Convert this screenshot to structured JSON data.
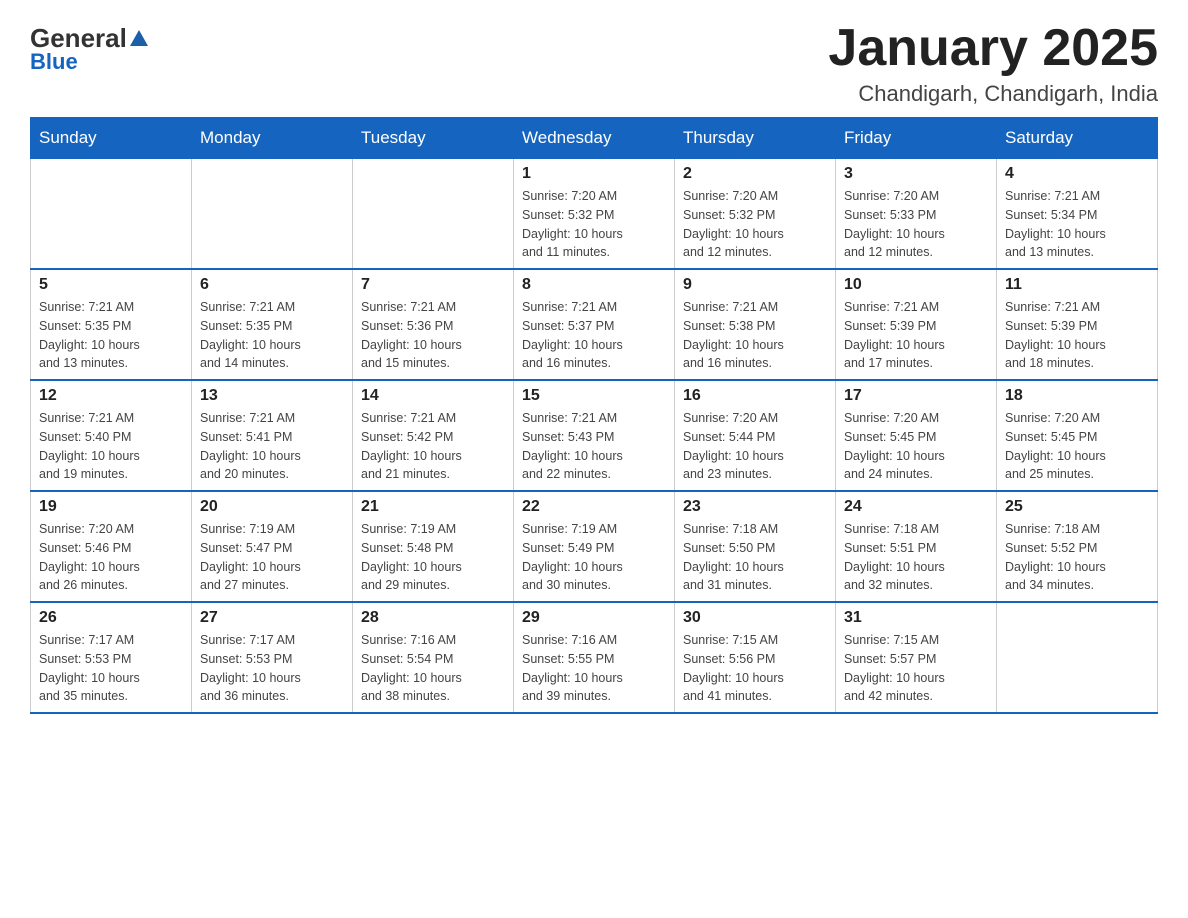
{
  "header": {
    "logo_general": "General",
    "logo_blue": "Blue",
    "month_title": "January 2025",
    "location": "Chandigarh, Chandigarh, India"
  },
  "days_of_week": [
    "Sunday",
    "Monday",
    "Tuesday",
    "Wednesday",
    "Thursday",
    "Friday",
    "Saturday"
  ],
  "weeks": [
    [
      {
        "day": "",
        "info": ""
      },
      {
        "day": "",
        "info": ""
      },
      {
        "day": "",
        "info": ""
      },
      {
        "day": "1",
        "info": "Sunrise: 7:20 AM\nSunset: 5:32 PM\nDaylight: 10 hours\nand 11 minutes."
      },
      {
        "day": "2",
        "info": "Sunrise: 7:20 AM\nSunset: 5:32 PM\nDaylight: 10 hours\nand 12 minutes."
      },
      {
        "day": "3",
        "info": "Sunrise: 7:20 AM\nSunset: 5:33 PM\nDaylight: 10 hours\nand 12 minutes."
      },
      {
        "day": "4",
        "info": "Sunrise: 7:21 AM\nSunset: 5:34 PM\nDaylight: 10 hours\nand 13 minutes."
      }
    ],
    [
      {
        "day": "5",
        "info": "Sunrise: 7:21 AM\nSunset: 5:35 PM\nDaylight: 10 hours\nand 13 minutes."
      },
      {
        "day": "6",
        "info": "Sunrise: 7:21 AM\nSunset: 5:35 PM\nDaylight: 10 hours\nand 14 minutes."
      },
      {
        "day": "7",
        "info": "Sunrise: 7:21 AM\nSunset: 5:36 PM\nDaylight: 10 hours\nand 15 minutes."
      },
      {
        "day": "8",
        "info": "Sunrise: 7:21 AM\nSunset: 5:37 PM\nDaylight: 10 hours\nand 16 minutes."
      },
      {
        "day": "9",
        "info": "Sunrise: 7:21 AM\nSunset: 5:38 PM\nDaylight: 10 hours\nand 16 minutes."
      },
      {
        "day": "10",
        "info": "Sunrise: 7:21 AM\nSunset: 5:39 PM\nDaylight: 10 hours\nand 17 minutes."
      },
      {
        "day": "11",
        "info": "Sunrise: 7:21 AM\nSunset: 5:39 PM\nDaylight: 10 hours\nand 18 minutes."
      }
    ],
    [
      {
        "day": "12",
        "info": "Sunrise: 7:21 AM\nSunset: 5:40 PM\nDaylight: 10 hours\nand 19 minutes."
      },
      {
        "day": "13",
        "info": "Sunrise: 7:21 AM\nSunset: 5:41 PM\nDaylight: 10 hours\nand 20 minutes."
      },
      {
        "day": "14",
        "info": "Sunrise: 7:21 AM\nSunset: 5:42 PM\nDaylight: 10 hours\nand 21 minutes."
      },
      {
        "day": "15",
        "info": "Sunrise: 7:21 AM\nSunset: 5:43 PM\nDaylight: 10 hours\nand 22 minutes."
      },
      {
        "day": "16",
        "info": "Sunrise: 7:20 AM\nSunset: 5:44 PM\nDaylight: 10 hours\nand 23 minutes."
      },
      {
        "day": "17",
        "info": "Sunrise: 7:20 AM\nSunset: 5:45 PM\nDaylight: 10 hours\nand 24 minutes."
      },
      {
        "day": "18",
        "info": "Sunrise: 7:20 AM\nSunset: 5:45 PM\nDaylight: 10 hours\nand 25 minutes."
      }
    ],
    [
      {
        "day": "19",
        "info": "Sunrise: 7:20 AM\nSunset: 5:46 PM\nDaylight: 10 hours\nand 26 minutes."
      },
      {
        "day": "20",
        "info": "Sunrise: 7:19 AM\nSunset: 5:47 PM\nDaylight: 10 hours\nand 27 minutes."
      },
      {
        "day": "21",
        "info": "Sunrise: 7:19 AM\nSunset: 5:48 PM\nDaylight: 10 hours\nand 29 minutes."
      },
      {
        "day": "22",
        "info": "Sunrise: 7:19 AM\nSunset: 5:49 PM\nDaylight: 10 hours\nand 30 minutes."
      },
      {
        "day": "23",
        "info": "Sunrise: 7:18 AM\nSunset: 5:50 PM\nDaylight: 10 hours\nand 31 minutes."
      },
      {
        "day": "24",
        "info": "Sunrise: 7:18 AM\nSunset: 5:51 PM\nDaylight: 10 hours\nand 32 minutes."
      },
      {
        "day": "25",
        "info": "Sunrise: 7:18 AM\nSunset: 5:52 PM\nDaylight: 10 hours\nand 34 minutes."
      }
    ],
    [
      {
        "day": "26",
        "info": "Sunrise: 7:17 AM\nSunset: 5:53 PM\nDaylight: 10 hours\nand 35 minutes."
      },
      {
        "day": "27",
        "info": "Sunrise: 7:17 AM\nSunset: 5:53 PM\nDaylight: 10 hours\nand 36 minutes."
      },
      {
        "day": "28",
        "info": "Sunrise: 7:16 AM\nSunset: 5:54 PM\nDaylight: 10 hours\nand 38 minutes."
      },
      {
        "day": "29",
        "info": "Sunrise: 7:16 AM\nSunset: 5:55 PM\nDaylight: 10 hours\nand 39 minutes."
      },
      {
        "day": "30",
        "info": "Sunrise: 7:15 AM\nSunset: 5:56 PM\nDaylight: 10 hours\nand 41 minutes."
      },
      {
        "day": "31",
        "info": "Sunrise: 7:15 AM\nSunset: 5:57 PM\nDaylight: 10 hours\nand 42 minutes."
      },
      {
        "day": "",
        "info": ""
      }
    ]
  ]
}
